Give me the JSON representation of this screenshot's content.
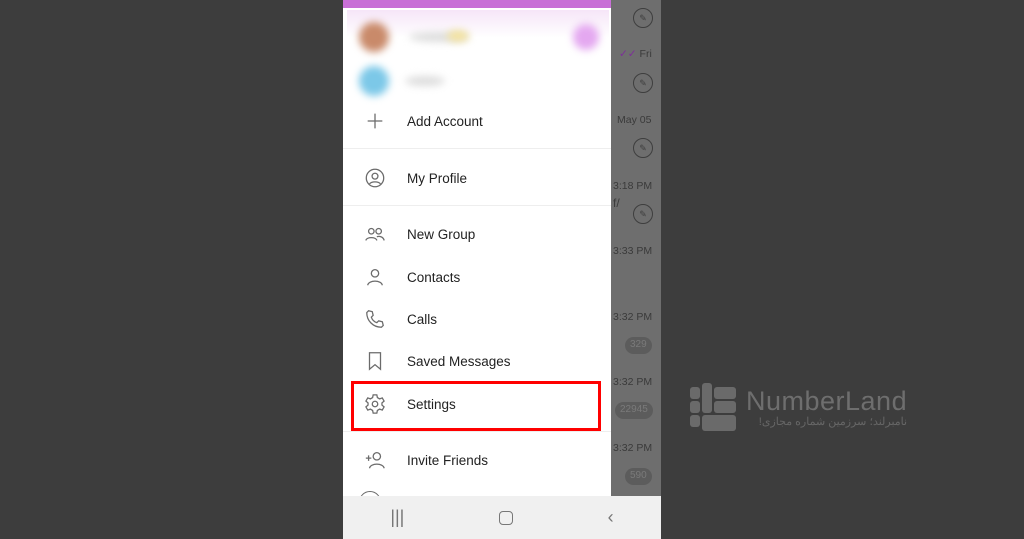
{
  "drawer": {
    "items": [
      {
        "label": "Add Account",
        "icon": "plus-icon"
      },
      {
        "label": "My Profile",
        "icon": "profile-icon"
      },
      {
        "label": "New Group",
        "icon": "group-icon"
      },
      {
        "label": "Contacts",
        "icon": "contact-icon"
      },
      {
        "label": "Calls",
        "icon": "phone-icon"
      },
      {
        "label": "Saved Messages",
        "icon": "bookmark-icon"
      },
      {
        "label": "Settings",
        "icon": "gear-icon"
      },
      {
        "label": "Invite Friends",
        "icon": "invite-icon"
      }
    ]
  },
  "chats": {
    "times": [
      "Fri",
      "May 05",
      "3:18 PM",
      "3:33 PM",
      "3:32 PM",
      "3:32 PM",
      "3:32 PM"
    ],
    "snippet": "f/",
    "badges": [
      "329",
      "22945",
      "590"
    ]
  },
  "watermark": {
    "brand": "NumberLand",
    "tagline": "نامبرلند؛ سرزمین شماره مجازی!"
  },
  "colors": {
    "accent": "#c86fd6",
    "highlight": "#ff0000"
  }
}
